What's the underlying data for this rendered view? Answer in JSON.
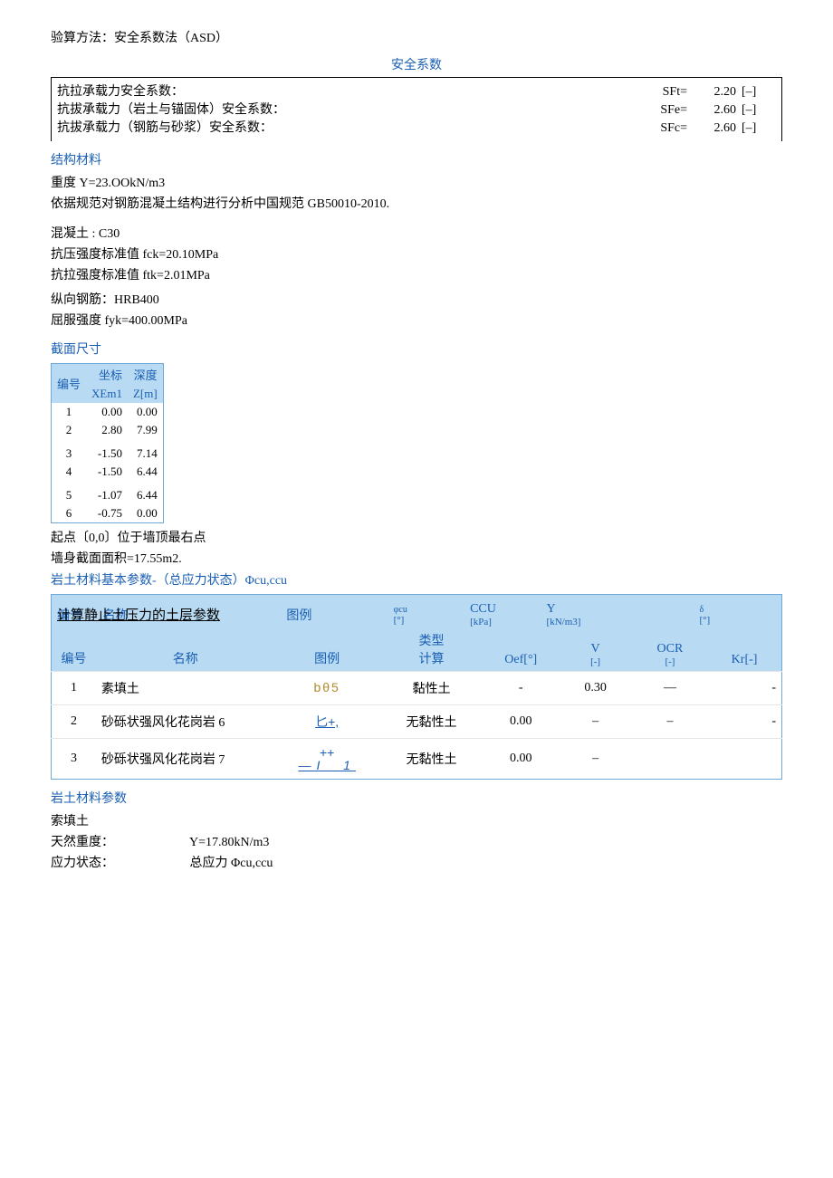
{
  "top_line": "验算方法：安全系数法（ASD）",
  "safety": {
    "title": "安全系数",
    "rows": [
      {
        "label": "抗拉承载力安全系数：",
        "sym": "SFt=",
        "val": "2.20",
        "unit": "[–]"
      },
      {
        "label": "抗拔承载力（岩土与锚固体）安全系数：",
        "sym": "SFe=",
        "val": "2.60",
        "unit": "[–]"
      },
      {
        "label": "抗拔承载力（钢筋与砂浆）安全系数：",
        "sym": "SFc=",
        "val": "2.60",
        "unit": "[–]"
      }
    ]
  },
  "struct": {
    "title": "结构材料",
    "l1": "重度 Y=23.OOkN/m3",
    "l2": "依据规范对钢筋混凝土结构进行分析中国规范 GB50010-2010.",
    "l3": "混凝土 : C30",
    "l4": "抗压强度标准值 fck=20.10MPa",
    "l5": "抗拉强度标准值 ftk=2.01MPa",
    "l6": "纵向钢筋：HRB400",
    "l7": "屈服强度 fyk=400.00MPa"
  },
  "cross": {
    "title": "截面尺寸",
    "h1": "编号",
    "h2": "坐标",
    "h3": "深度",
    "sub2": "XEm1",
    "sub3": "Z[m]",
    "rows": [
      {
        "n": "1",
        "x": "0.00",
        "z": "0.00"
      },
      {
        "n": "2",
        "x": "2.80",
        "z": "7.99"
      },
      {
        "n": "3",
        "x": "-1.50",
        "z": "7.14"
      },
      {
        "n": "4",
        "x": "-1.50",
        "z": "6.44"
      },
      {
        "n": "5",
        "x": "-1.07",
        "z": "6.44"
      },
      {
        "n": "6",
        "x": "-0.75",
        "z": "0.00"
      }
    ],
    "note1": "起点〔0,0〕位于墙顶最右点",
    "note2": "墙身截面面积=17.55m2."
  },
  "soil_basic": {
    "title": "岩土材料基本参数-（总应力状态）Φcu,ccu",
    "bar": {
      "h1": "编号",
      "h2": "名称",
      "h3": "图例",
      "h4": "φcu",
      "h5": "CCU",
      "h6": "Y",
      "h7": "δ",
      "u4": "[°]",
      "u5": "[kPa]",
      "u6": "[kN/m3]",
      "u7": "[°]"
    },
    "caption": "计算静止土压力的土层参数",
    "head": {
      "h1": "编号",
      "h2": "名称",
      "h3": "图例",
      "h4a": "类型",
      "h4b": "计算",
      "h5": "Oef[°]",
      "h6": "V",
      "h6u": "[-]",
      "h7": "OCR",
      "h7u": "[-]",
      "h8": "Kr[-]"
    },
    "rows": [
      {
        "idx": "1",
        "name": "素填土",
        "pat": "bθ5",
        "type": "黏性土",
        "oef": "-",
        "v": "0.30",
        "ocr": "—",
        "kr": "-"
      },
      {
        "idx": "2",
        "name": "砂砾状强风化花岗岩 6",
        "pat": "匕+,",
        "type": "无黏性土",
        "oef": "0.00",
        "v": "–",
        "ocr": "–",
        "kr": "-"
      },
      {
        "idx": "3",
        "name": "砂砾状强风化花岗岩 7",
        "pat": "++",
        "type": "无黏性土",
        "oef": "0.00",
        "v": "–",
        "ocr": "",
        "kr": ""
      }
    ]
  },
  "soil_params": {
    "title": "岩土材料参数",
    "name": "索填土",
    "r1l": "天然重度：",
    "r1v": "Y=17.80kN/m3",
    "r2l": "应力状态：",
    "r2v": "总应力 Φcu,ccu"
  }
}
